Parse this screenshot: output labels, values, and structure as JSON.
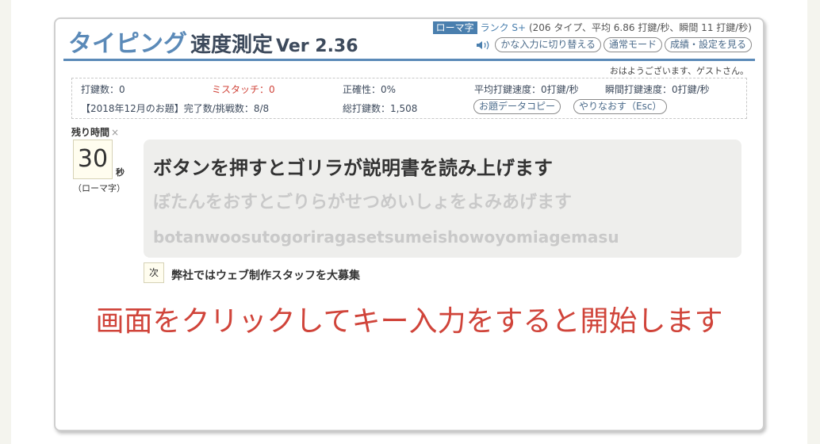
{
  "header": {
    "title_main": "タイピング",
    "title_sub": "速度測定",
    "version": "Ver 2.36",
    "mode_tag": "ローマ字",
    "rank_text": "ランク S+",
    "rank_detail": "(206 タイプ、平均 6.86 打鍵/秒、瞬間 11 打鍵/秒)",
    "speaker_icon": "speaker-icon",
    "buttons": {
      "kana_switch": "かな入力に切り替える",
      "normal_mode": "通常モード",
      "results_settings": "成績・設定を見る"
    },
    "greeting": "おはようございます、ゲストさん。"
  },
  "stats": {
    "keystrokes": "打鍵数：0",
    "mistouch": "ミスタッチ：0",
    "accuracy": "正確性：0%",
    "avg_speed": "平均打鍵速度：0打鍵/秒",
    "instant_speed": "瞬間打鍵速度：0打鍵/秒",
    "challenge": "【2018年12月のお題】完了数/挑戦数：8/8",
    "total_keystrokes": "総打鍵数：1,508",
    "copy_button": "お題データコピー",
    "retry_button": "やりなおす（Esc）"
  },
  "timer": {
    "label": "残り時間",
    "close": "×",
    "value": "30",
    "unit": "秒",
    "mode": "（ローマ字）"
  },
  "word": {
    "kanji": "ボタンを押すとゴリラが説明書を読み上げます",
    "kana": "ぼたんをおすとごりらがせつめいしょをよみあげます",
    "romaji": "botanwoosutogoriragasetsumeishowoyomiagemasu"
  },
  "next": {
    "tag": "次",
    "text": "弊社ではウェブ制作スタッフを大募集"
  },
  "start_message": "画面をクリックしてキー入力をすると開始します",
  "colors": {
    "accent": "#5b8ab8",
    "error": "#d0443a"
  }
}
